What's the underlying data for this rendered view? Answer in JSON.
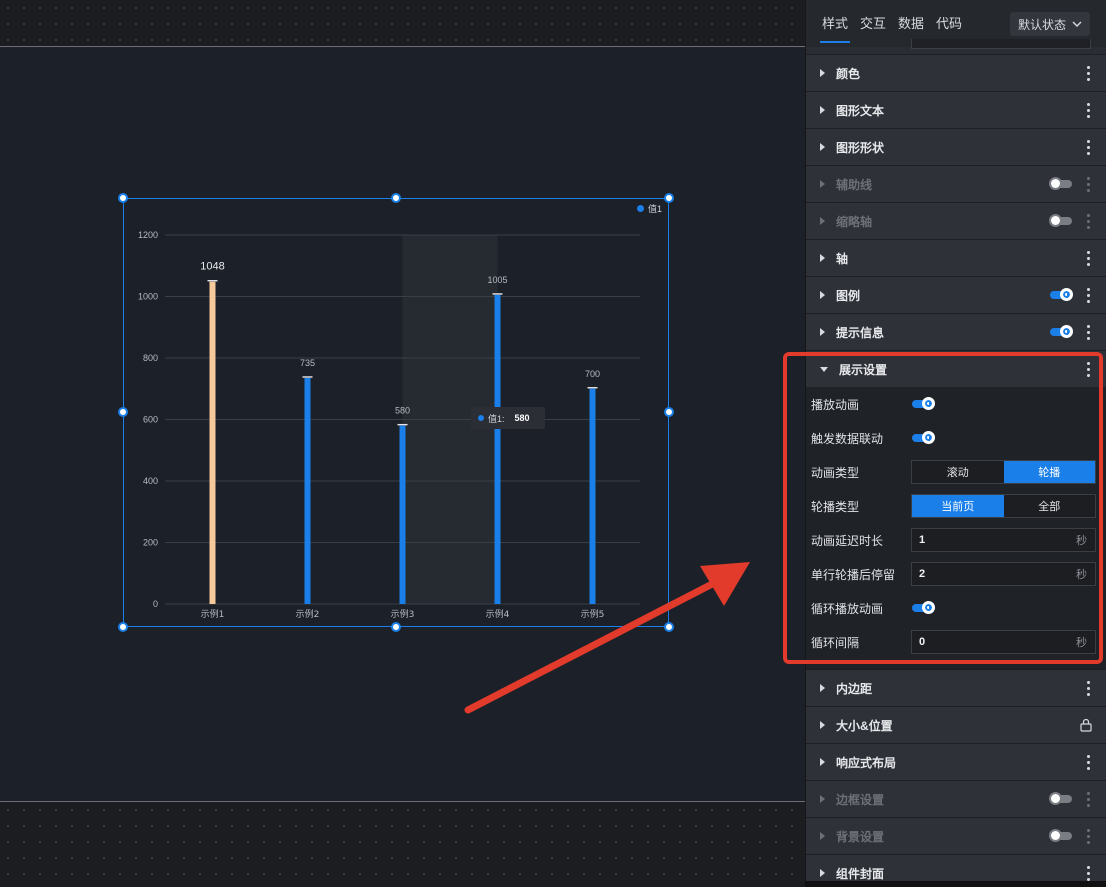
{
  "chart_data": {
    "type": "bar",
    "categories": [
      "示例1",
      "示例2",
      "示例3",
      "示例4",
      "示例5"
    ],
    "series": [
      {
        "name": "值1",
        "values": [
          1048,
          735,
          580,
          1005,
          700
        ]
      }
    ],
    "ylim": [
      0,
      1200
    ],
    "yticks": [
      "0",
      "200",
      "400",
      "600",
      "800",
      "1000",
      "1200"
    ],
    "highlight_index": 0,
    "legend": "top-right",
    "grid": true,
    "colors": {
      "bar": "#1a7fe8",
      "highlight": "#f5c999"
    }
  },
  "tooltip": {
    "label": "值1:",
    "value": "580"
  },
  "panel": {
    "tabs": [
      "样式",
      "交互",
      "数据",
      "代码"
    ],
    "state_select": "默认状态",
    "sections_top": [
      {
        "title": "颜色"
      },
      {
        "title": "图形文本"
      },
      {
        "title": "图形形状"
      },
      {
        "title": "辅助线"
      },
      {
        "title": "缩略轴"
      },
      {
        "title": "轴"
      },
      {
        "title": "图例"
      },
      {
        "title": "提示信息"
      }
    ],
    "display": {
      "title": "展示设置",
      "play_animation": "播放动画",
      "trigger_link": "触发数据联动",
      "anim_type": "动画类型",
      "anim_type_options": [
        "滚动",
        "轮播"
      ],
      "carousel_type": "轮播类型",
      "carousel_type_options": [
        "当前页",
        "全部"
      ],
      "delay_label": "动画延迟时长",
      "delay_value": "1",
      "pause_label": "单行轮播后停留",
      "pause_value": "2",
      "loop_label": "循环播放动画",
      "interval_label": "循环间隔",
      "interval_value": "0",
      "unit": "秒"
    },
    "sections_bottom": [
      {
        "title": "内边距"
      },
      {
        "title": "大小&位置"
      },
      {
        "title": "响应式布局"
      },
      {
        "title": "边框设置"
      },
      {
        "title": "背景设置"
      },
      {
        "title": "组件封面"
      }
    ]
  }
}
